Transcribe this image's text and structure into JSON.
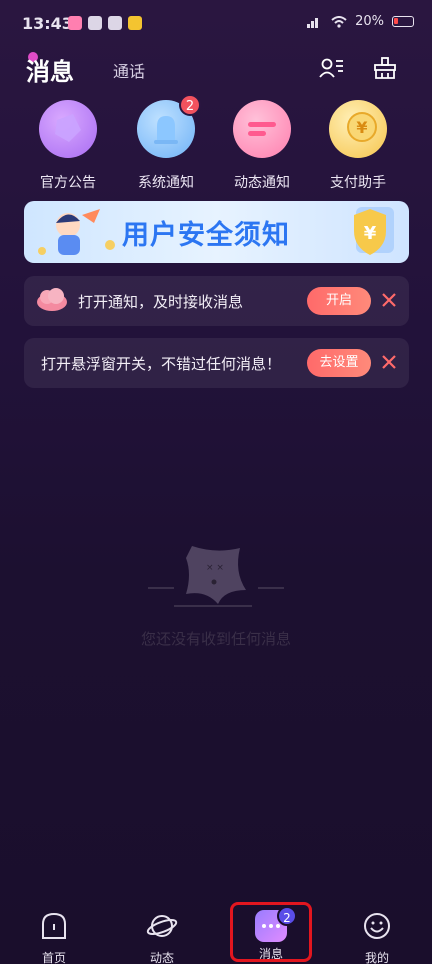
{
  "status_bar": {
    "time": "13:43",
    "battery": "20%"
  },
  "header": {
    "title": "消息",
    "tab_call": "通话"
  },
  "quick_entries": [
    {
      "label": "官方公告",
      "icon": "announcement-icon",
      "badge": ""
    },
    {
      "label": "系统通知",
      "icon": "bell-icon",
      "badge": "2"
    },
    {
      "label": "动态通知",
      "icon": "feed-icon",
      "badge": ""
    },
    {
      "label": "支付助手",
      "icon": "yen-coin-icon",
      "badge": ""
    }
  ],
  "banner": {
    "text": "用户安全须知"
  },
  "notices": [
    {
      "text": "打开通知，及时接收消息",
      "button": "开启"
    },
    {
      "text": "打开悬浮窗开关，不错过任何消息！",
      "button": "去设置"
    }
  ],
  "empty_state": {
    "text": "您还没有收到任何消息"
  },
  "bottom_nav": [
    {
      "label": "首页",
      "icon": "home-icon",
      "badge": ""
    },
    {
      "label": "动态",
      "icon": "planet-icon",
      "badge": ""
    },
    {
      "label": "消息",
      "icon": "chat-icon",
      "badge": "2"
    },
    {
      "label": "我的",
      "icon": "smiley-icon",
      "badge": ""
    }
  ],
  "colors": {
    "accent": "#ff6a6a",
    "badge_red": "#f2525e",
    "badge_purple": "#5a4de8",
    "banner_text": "#2c76f2",
    "highlight": "#e3161f"
  }
}
